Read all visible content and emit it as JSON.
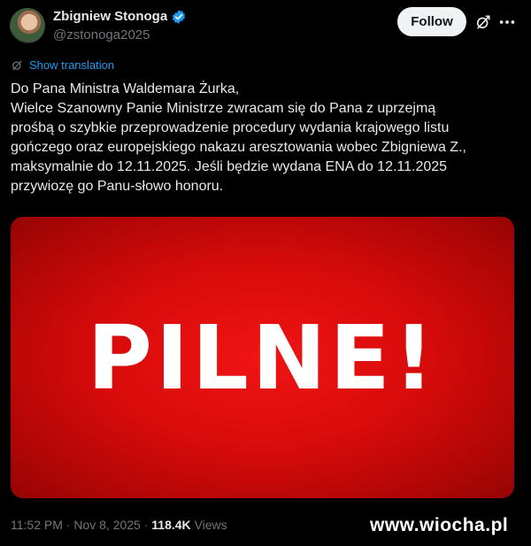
{
  "author": {
    "name": "Zbigniew Stonoga",
    "handle": "@zstonoga2025"
  },
  "actions": {
    "follow_label": "Follow"
  },
  "icons": {
    "verified": "verified-badge-icon",
    "grok": "grok-icon",
    "more": "more-options-icon",
    "translate": "translate-icon"
  },
  "translation_link": "Show translation",
  "tweet": {
    "lines": [
      "Do Pana Ministra Waldemara Żurka,",
      "Wielce Szanowny Panie Ministrze zwracam się do Pana z uprzejmą",
      "prośbą o szybkie przeprowadzenie procedury wydania krajowego listu",
      "gończego oraz europejskiego nakazu aresztowania wobec Zbigniewa Z.,",
      "maksymalnie do 12.11.2025. Jeśli będzie wydana ENA do 12.11.2025",
      "przywiozę go Panu-słowo honoru."
    ]
  },
  "media": {
    "text": "PILNE!"
  },
  "meta": {
    "time": "11:52 PM",
    "separator": " · ",
    "date": "Nov 8, 2025",
    "views_count": "118.4K",
    "views_label": "Views"
  },
  "watermark": "www.wiocha.pl",
  "colors": {
    "background": "#000000",
    "text": "#e7e9ea",
    "muted": "#71767b",
    "accent": "#1d9bf0",
    "media_red": "#e00d0d"
  }
}
